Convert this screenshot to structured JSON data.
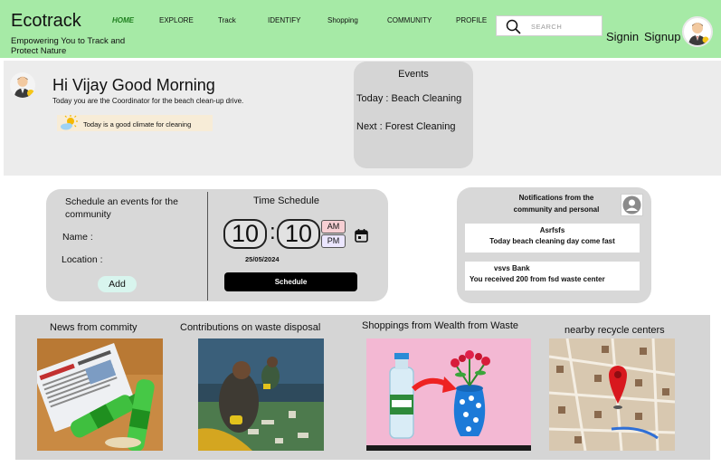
{
  "header": {
    "logo": "Ecotrack",
    "tagline": "Empowering You to Track and Protect Nature",
    "nav": [
      "HOME",
      "EXPLORE",
      "Track",
      "IDENTIFY",
      "Shopping",
      "COMMUNITY",
      "PROFILE"
    ],
    "active_nav": "HOME",
    "search_placeholder": "SEARCH",
    "signin": "Signin",
    "signup": "Signup"
  },
  "greeting": {
    "title": "Hi Vijay Good Morning",
    "subtitle": "Today you are the Coordinator for the beach clean-up drive.",
    "weather": "Today is a good climate for cleaning"
  },
  "events": {
    "title": "Events",
    "today": "Today : Beach Cleaning",
    "next": "Next : Forest Cleaning"
  },
  "schedule": {
    "title": "Schedule an events for the community",
    "name_label": "Name :",
    "location_label": "Location :",
    "add_label": "Add",
    "time_title": "Time Schedule",
    "hour": "10",
    "minute": "10",
    "am": "AM",
    "pm": "PM",
    "date": "25/05/2024",
    "schedule_label": "Schedule"
  },
  "notifications": {
    "title": "Notifications from the community and personal",
    "items": [
      {
        "name": "Asrfsfs",
        "message": "Today beach cleaning day come fast"
      },
      {
        "name": "vsvs Bank",
        "message": "You received 200 from fsd waste center"
      }
    ]
  },
  "cards": [
    {
      "title": "News from commity"
    },
    {
      "title": "Contributions on waste disposal"
    },
    {
      "title": "Shoppings from Wealth from Waste"
    },
    {
      "title": "nearby recycle centers"
    }
  ],
  "colors": {
    "header_bg": "#a6eaa6",
    "active_nav": "#1e7f1e",
    "panel_bg": "#d8d8d8"
  }
}
